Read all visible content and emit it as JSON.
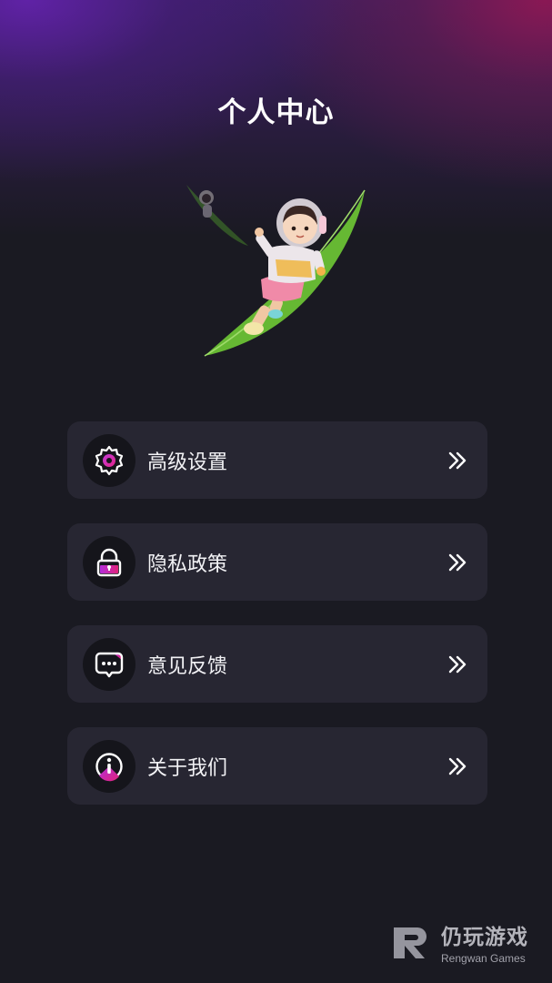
{
  "header": {
    "title": "个人中心"
  },
  "hero": {
    "image": "astronaut-girl-on-leaf"
  },
  "menu": {
    "items": [
      {
        "label": "高级设置",
        "icon": "gear-icon"
      },
      {
        "label": "隐私政策",
        "icon": "lock-icon"
      },
      {
        "label": "意见反馈",
        "icon": "chat-bubble-icon"
      },
      {
        "label": "关于我们",
        "icon": "info-icon"
      }
    ]
  },
  "watermark": {
    "name": "仍玩游戏",
    "subtitle": "Rengwan Games"
  },
  "colors": {
    "background": "#1a1a22",
    "card": "#272632",
    "accent_purple": "#b32ddb",
    "accent_magenta": "#e0247a",
    "leaf_green": "#6ec238"
  }
}
